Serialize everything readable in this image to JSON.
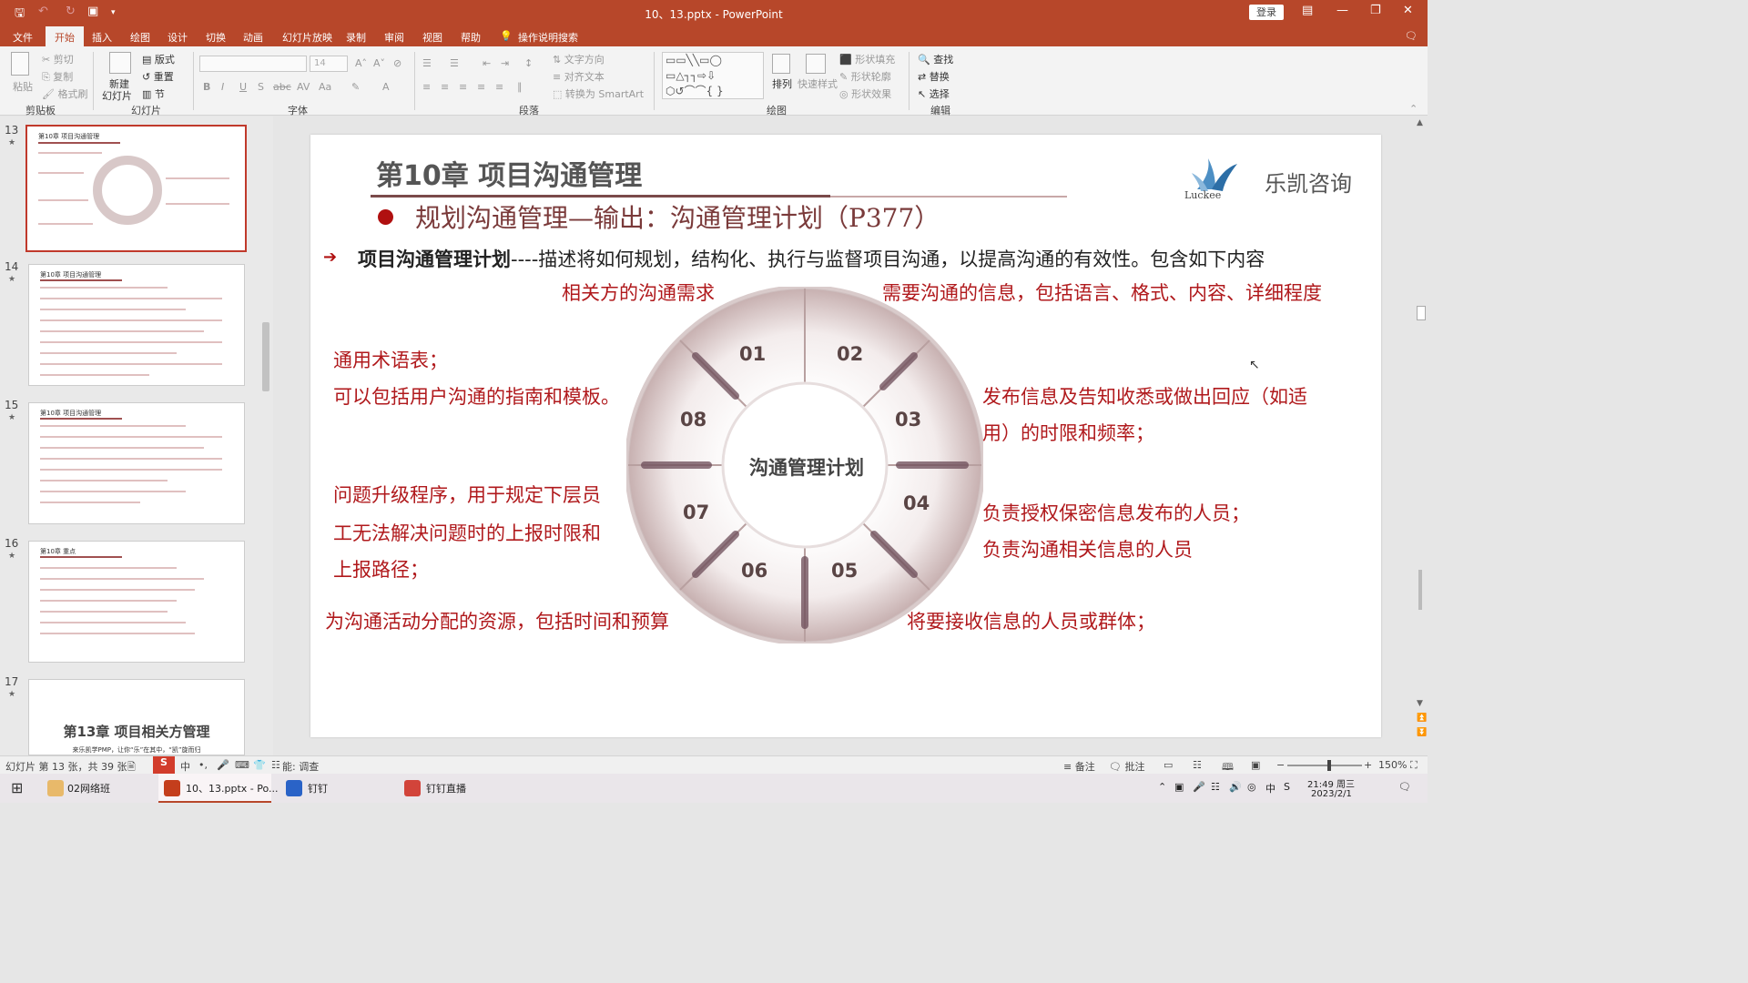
{
  "window": {
    "title": "10、13.pptx - PowerPoint",
    "login": "登录"
  },
  "menu": [
    "文件",
    "开始",
    "插入",
    "绘图",
    "设计",
    "切换",
    "动画",
    "幻灯片放映",
    "录制",
    "审阅",
    "视图",
    "帮助",
    "操作说明搜索"
  ],
  "ribbon": {
    "groups": [
      "剪贴板",
      "幻灯片",
      "字体",
      "段落",
      "绘图",
      "编辑"
    ],
    "clipboard": {
      "paste": "粘贴",
      "cut": "剪切",
      "copy": "复制",
      "format": "格式刷"
    },
    "slides": {
      "new": "新建",
      "new2": "幻灯片",
      "layout": "版式",
      "reset": "重置",
      "section": "节"
    },
    "font_size": "14",
    "paragraph": {
      "text_dir": "文字方向",
      "align_text": "对齐文本",
      "smartart": "转换为 SmartArt"
    },
    "drawing": {
      "arrange": "排列",
      "quick_styles": "快速样式",
      "fill": "形状填充",
      "outline": "形状轮廓",
      "effects": "形状效果"
    },
    "editing": {
      "find": "查找",
      "replace": "替换",
      "select": "选择"
    }
  },
  "thumbnails": [
    {
      "num": "13",
      "title": "第10章 项目沟通管理"
    },
    {
      "num": "14",
      "title": "第10章 项目沟通管理"
    },
    {
      "num": "15",
      "title": "第10章 项目沟通管理"
    },
    {
      "num": "16",
      "title": "第10章 重点"
    },
    {
      "num": "17",
      "title": "第13章  项目相关方管理",
      "subtitle": "来乐凯学PMP，让你“乐”在其中，“凯”旋而归"
    }
  ],
  "slide": {
    "chapter": "第10章 项目沟通管理",
    "logo_text": "乐凯咨询",
    "logo_word": "Luckee",
    "subtitle": "规划沟通管理—输出：沟通管理计划（P377）",
    "desc_bold": "项目沟通管理计划",
    "desc_rest": "----描述将如何规划，结构化、执行与监督项目沟通，以提高沟通的有效性。包含如下内容",
    "center": "沟通管理计划",
    "numbers": [
      "01",
      "02",
      "03",
      "04",
      "05",
      "06",
      "07",
      "08"
    ],
    "items": {
      "s01": "相关方的沟通需求",
      "s02": "需要沟通的信息，包括语言、格式、内容、详细程度",
      "s03a": "发布信息及告知收悉或做出回应（如适",
      "s03b": "用）的时限和频率；",
      "s04a": "负责授权保密信息发布的人员；",
      "s04b": "负责沟通相关信息的人员",
      "s05": "将要接收信息的人员或群体；",
      "s06": "为沟通活动分配的资源，包括时间和预算",
      "s07a": "问题升级程序，用于规定下层员",
      "s07b": "工无法解决问题时的上报时限和",
      "s07c": "上报路径；",
      "s08a": "通用术语表；",
      "s08b": "可以包括用户沟通的指南和模板。"
    }
  },
  "status": {
    "slide_info": "幻灯片 第 13 张，共 39 张",
    "lang": "中",
    "access": "能: 调查",
    "notes": "备注",
    "comments": "批注",
    "zoom": "150%"
  },
  "taskbar": {
    "items": [
      "02网络班",
      "10、13.pptx - Po...",
      "钉钉",
      "钉钉直播"
    ],
    "time": "21:49 周三",
    "date": "2023/2/1"
  },
  "colors": {
    "accent": "#b7472a",
    "slide_red": "#b0191c",
    "title_gray": "#555555"
  }
}
